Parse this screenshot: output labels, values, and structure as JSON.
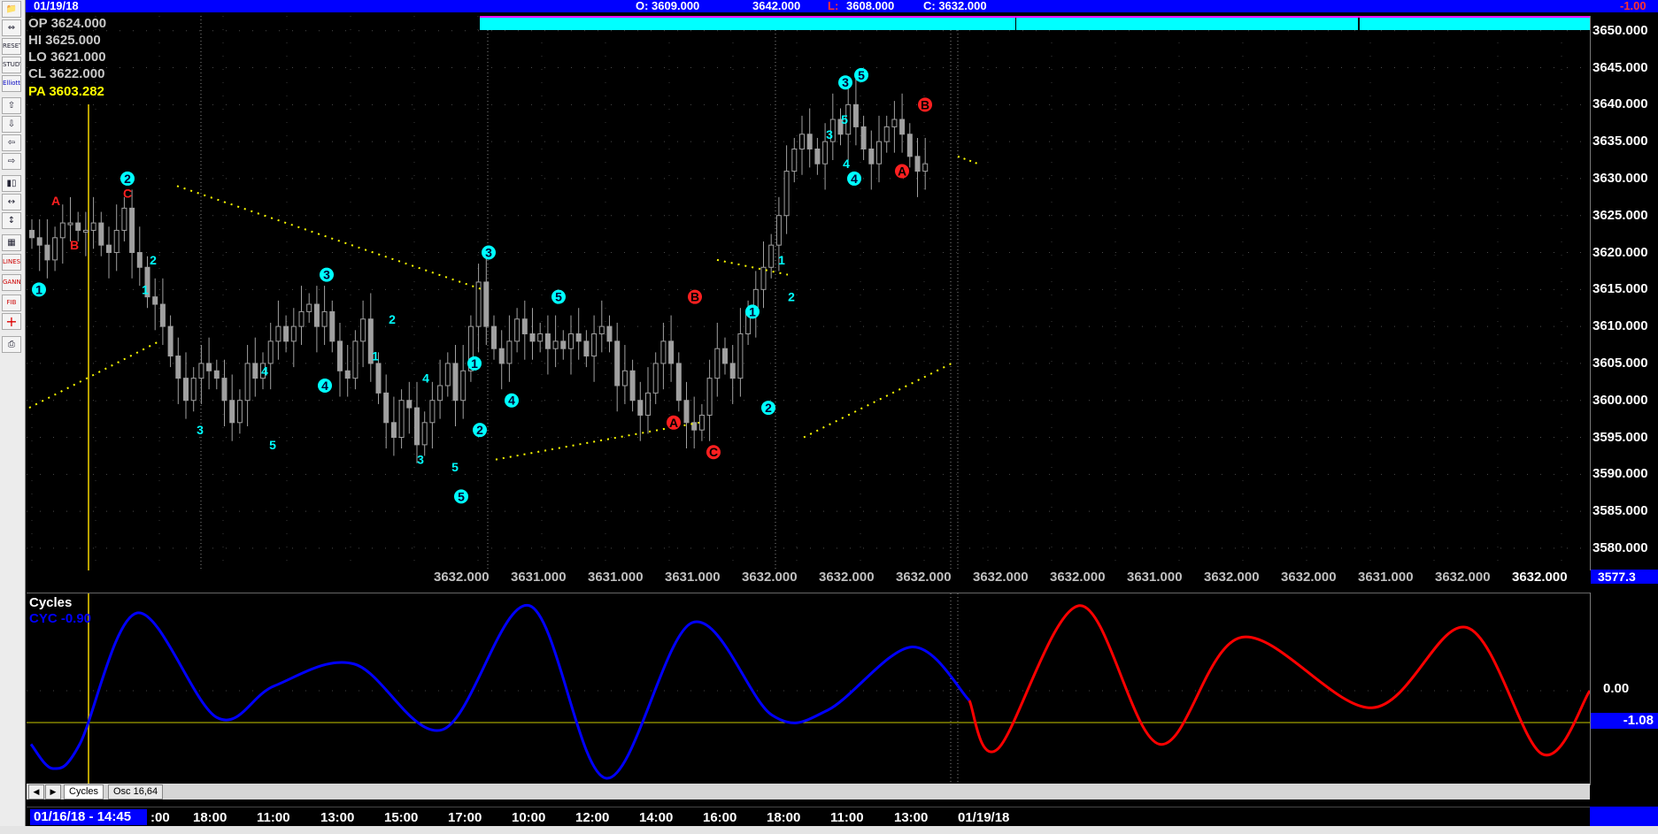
{
  "topbar": {
    "date": "01/19/18",
    "open": "O: 3609.000",
    "high": "3642.000",
    "low_label": "L:",
    "low": "3608.000",
    "close": "C: 3632.000",
    "right_value": "-1.00"
  },
  "toolbar": {
    "buttons": [
      "open",
      "zoom",
      "reset",
      "study",
      "elliott",
      "up",
      "down",
      "left",
      "right",
      "candles",
      "bars",
      "scale",
      "grid",
      "lines",
      "gann",
      "fib",
      "crosshair",
      "print"
    ],
    "labels": {
      "reset": "RESET",
      "study": "STUDY",
      "elliott": "Elliott",
      "lines": "LINES",
      "gann": "GANN",
      "fib": "FIB"
    }
  },
  "ohlc": {
    "op": "OP  3624.000",
    "hi": "HI   3625.000",
    "lo": "LO  3621.000",
    "cl": "CL  3622.000",
    "pa": "PA  3603.282"
  },
  "price_axis": {
    "ticks": [
      "3650.000",
      "3645.000",
      "3640.000",
      "3635.000",
      "3630.000",
      "3625.000",
      "3620.000",
      "3615.000",
      "3610.000",
      "3605.000",
      "3600.000",
      "3595.000",
      "3590.000",
      "3585.000",
      "3580.000"
    ],
    "current": "3577.3"
  },
  "projection_row": {
    "values": [
      "3632.000",
      "3631.000",
      "3631.000",
      "3631.000",
      "3632.000",
      "3632.000",
      "3632.000",
      "3632.000",
      "3632.000",
      "3631.000",
      "3632.000",
      "3632.000",
      "3631.000",
      "3632.000",
      "3632.000"
    ]
  },
  "chart_data": {
    "type": "candlestick",
    "ylim": [
      3577,
      3652
    ],
    "wave_labels": [
      {
        "text": "1",
        "circled": true,
        "color": "cyan"
      },
      {
        "text": "A",
        "circled": false,
        "color": "red"
      },
      {
        "text": "B",
        "circled": false,
        "color": "red"
      },
      {
        "text": "2",
        "circled": true,
        "color": "cyan"
      },
      {
        "text": "C",
        "circled": false,
        "color": "red"
      },
      {
        "text": "2",
        "circled": false,
        "color": "cyan"
      },
      {
        "text": "1",
        "circled": false,
        "color": "cyan"
      },
      {
        "text": "3",
        "circled": false,
        "color": "cyan"
      },
      {
        "text": "4",
        "circled": false,
        "color": "cyan"
      },
      {
        "text": "5",
        "circled": false,
        "color": "cyan"
      },
      {
        "text": "3",
        "circled": true,
        "color": "cyan"
      },
      {
        "text": "4",
        "circled": true,
        "color": "cyan"
      },
      {
        "text": "1",
        "circled": false,
        "color": "cyan"
      },
      {
        "text": "2",
        "circled": false,
        "color": "cyan"
      },
      {
        "text": "4",
        "circled": false,
        "color": "cyan"
      },
      {
        "text": "3",
        "circled": false,
        "color": "cyan"
      },
      {
        "text": "5",
        "circled": false,
        "color": "cyan"
      },
      {
        "text": "5",
        "circled": true,
        "color": "cyan"
      },
      {
        "text": "1",
        "circled": true,
        "color": "cyan"
      },
      {
        "text": "2",
        "circled": true,
        "color": "cyan"
      },
      {
        "text": "3",
        "circled": true,
        "color": "cyan"
      },
      {
        "text": "4",
        "circled": true,
        "color": "cyan"
      },
      {
        "text": "5",
        "circled": true,
        "color": "cyan"
      },
      {
        "text": "A",
        "circled": true,
        "color": "red"
      },
      {
        "text": "B",
        "circled": true,
        "color": "red"
      },
      {
        "text": "C",
        "circled": true,
        "color": "red"
      },
      {
        "text": "1",
        "circled": true,
        "color": "cyan"
      },
      {
        "text": "2",
        "circled": true,
        "color": "cyan"
      },
      {
        "text": "1",
        "circled": false,
        "color": "cyan"
      },
      {
        "text": "2",
        "circled": false,
        "color": "cyan"
      },
      {
        "text": "3",
        "circled": false,
        "color": "cyan"
      },
      {
        "text": "5",
        "circled": false,
        "color": "cyan"
      },
      {
        "text": "4",
        "circled": false,
        "color": "cyan"
      },
      {
        "text": "3",
        "circled": true,
        "color": "cyan"
      },
      {
        "text": "5",
        "circled": true,
        "color": "cyan"
      },
      {
        "text": "4",
        "circled": true,
        "color": "cyan"
      },
      {
        "text": "A",
        "circled": true,
        "color": "red"
      },
      {
        "text": "B",
        "circled": true,
        "color": "red"
      }
    ],
    "colors": {
      "candles": "#a0a0a0",
      "wave_cyan": "#00ffff",
      "wave_red": "#ff2020",
      "trend_dots": "#ffff00",
      "cyan_bar": "#00ffff"
    }
  },
  "oscillator": {
    "title": "Cycles",
    "value_label": "CYC -0.90",
    "axis_zero": "0.00",
    "axis_current": "-1.08",
    "colors": {
      "history": "#0000ff",
      "projection": "#ff0000",
      "baseline": "#c8c800"
    }
  },
  "tabs": {
    "items": [
      "Cycles",
      "Osc 16,64"
    ],
    "prev": "◀",
    "next": "▶"
  },
  "timebar": {
    "start": "01/16/18 - 14:45",
    "ticks": [
      ":00",
      "18:00",
      "11:00",
      "13:00",
      "15:00",
      "17:00",
      "10:00",
      "12:00",
      "14:00",
      "16:00",
      "18:00",
      "11:00",
      "13:00",
      "01/19/18"
    ]
  }
}
